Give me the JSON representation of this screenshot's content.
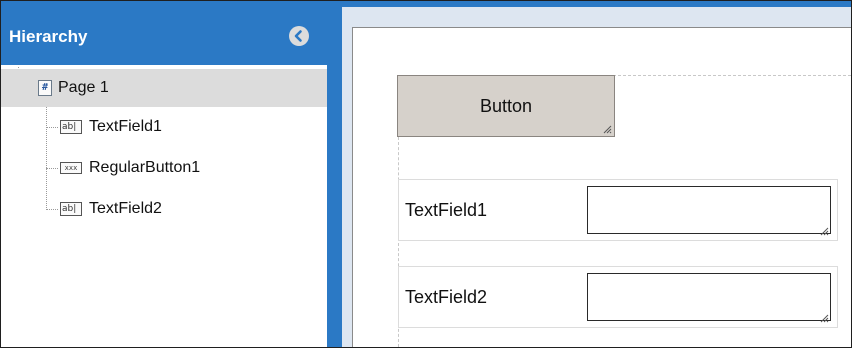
{
  "hierarchy": {
    "title": "Hierarchy",
    "collapse_icon": "chevron-left-icon",
    "accent_color": "#2b79c5",
    "selected_color": "#dcdcdc",
    "root": {
      "label": "Page 1",
      "icon": "page-icon",
      "icon_glyph": "#"
    },
    "children": [
      {
        "label": "TextField1",
        "icon": "text-field-icon",
        "icon_glyph": "ab|"
      },
      {
        "label": "RegularButton1",
        "icon": "button-icon",
        "icon_glyph": "xxx"
      },
      {
        "label": "TextField2",
        "icon": "text-field-icon",
        "icon_glyph": "ab|"
      }
    ]
  },
  "canvas": {
    "background": "#dde6f1",
    "button": {
      "label": "Button",
      "fill": "#d6d1cb"
    },
    "fields": [
      {
        "label": "TextField1",
        "value": ""
      },
      {
        "label": "TextField2",
        "value": ""
      }
    ]
  }
}
